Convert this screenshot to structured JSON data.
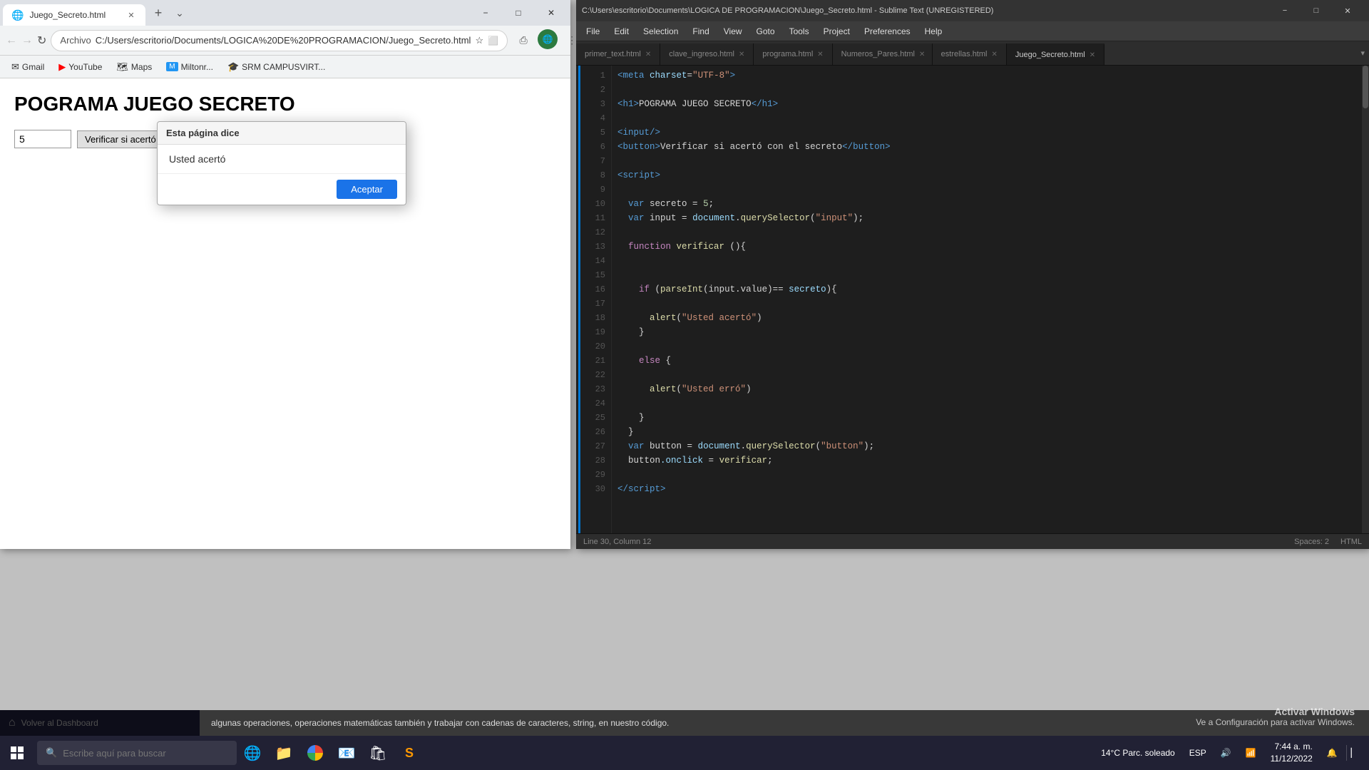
{
  "chrome": {
    "tab_title": "Juego_Secreto.html",
    "tab_favicon": "🌐",
    "address_protocol": "Archivo",
    "address_url": "C:/Users/escritorio/Documents/LOGICA%20DE%20PROGRAMACION/Juego_Secreto.html",
    "new_tab_label": "+",
    "win_controls": {
      "minimize": "−",
      "maximize": "□",
      "close": "✕"
    },
    "nav": {
      "back": "←",
      "forward": "→",
      "refresh": "↻"
    },
    "bookmarks": [
      {
        "label": "Gmail",
        "favicon": "✉"
      },
      {
        "label": "YouTube",
        "favicon": "▶"
      },
      {
        "label": "Maps",
        "favicon": "🗺"
      },
      {
        "label": "Miltonr...",
        "favicon": "M"
      },
      {
        "label": "SRM CAMPUSVIRT...",
        "favicon": "🎓"
      }
    ],
    "page": {
      "title": "POGRAMA JUEGO SECRETO",
      "input_value": "5",
      "button_label": "Verificar si acertó"
    },
    "alert": {
      "header": "Esta página dice",
      "message": "Usted acertó",
      "button": "Aceptar"
    }
  },
  "sublime": {
    "titlebar": "C:\\Users\\escritorio\\Documents\\LOGICA DE PROGRAMACION\\Juego_Secreto.html - Sublime Text (UNREGISTERED)",
    "win_controls": {
      "minimize": "−",
      "maximize": "□",
      "close": "✕"
    },
    "menu_items": [
      "File",
      "Edit",
      "Selection",
      "Find",
      "View",
      "Goto",
      "Tools",
      "Project",
      "Preferences",
      "Help"
    ],
    "tabs": [
      {
        "label": "primer_text.html",
        "active": false
      },
      {
        "label": "clave_ingreso.html",
        "active": false
      },
      {
        "label": "programa.html",
        "active": false
      },
      {
        "label": "Numeros_Pares.html",
        "active": false
      },
      {
        "label": "estrellas.html",
        "active": false
      },
      {
        "label": "Juego_Secreto.html",
        "active": true
      }
    ],
    "code_lines": [
      {
        "num": 1,
        "tokens": [
          {
            "text": "<",
            "cls": "kw-tag"
          },
          {
            "text": "meta",
            "cls": "kw-tag"
          },
          {
            "text": " charset",
            "cls": "kw-attr"
          },
          {
            "text": "=",
            "cls": "kw-plain"
          },
          {
            "text": "\"UTF-8\"",
            "cls": "kw-str"
          },
          {
            "text": ">",
            "cls": "kw-tag"
          }
        ]
      },
      {
        "num": 2,
        "tokens": []
      },
      {
        "num": 3,
        "tokens": [
          {
            "text": "<",
            "cls": "kw-tag"
          },
          {
            "text": "h1",
            "cls": "kw-tag"
          },
          {
            "text": ">",
            "cls": "kw-tag"
          },
          {
            "text": "POGRAMA JUEGO SECRETO",
            "cls": "kw-plain"
          },
          {
            "text": "</",
            "cls": "kw-tag"
          },
          {
            "text": "h1",
            "cls": "kw-tag"
          },
          {
            "text": ">",
            "cls": "kw-tag"
          }
        ]
      },
      {
        "num": 4,
        "tokens": []
      },
      {
        "num": 5,
        "tokens": [
          {
            "text": "<",
            "cls": "kw-tag"
          },
          {
            "text": "input",
            "cls": "kw-tag"
          },
          {
            "text": "/>",
            "cls": "kw-tag"
          }
        ]
      },
      {
        "num": 6,
        "tokens": [
          {
            "text": "<",
            "cls": "kw-tag"
          },
          {
            "text": "button",
            "cls": "kw-tag"
          },
          {
            "text": ">",
            "cls": "kw-tag"
          },
          {
            "text": "Verificar si acertó con el secreto",
            "cls": "kw-plain"
          },
          {
            "text": "</",
            "cls": "kw-tag"
          },
          {
            "text": "button",
            "cls": "kw-tag"
          },
          {
            "text": ">",
            "cls": "kw-tag"
          }
        ]
      },
      {
        "num": 7,
        "tokens": []
      },
      {
        "num": 8,
        "tokens": [
          {
            "text": "<",
            "cls": "kw-tag"
          },
          {
            "text": "script",
            "cls": "kw-tag"
          },
          {
            "text": ">",
            "cls": "kw-tag"
          }
        ]
      },
      {
        "num": 9,
        "tokens": []
      },
      {
        "num": 10,
        "tokens": [
          {
            "text": "  ",
            "cls": "kw-plain"
          },
          {
            "text": "var",
            "cls": "kw-blue"
          },
          {
            "text": " secreto ",
            "cls": "kw-plain"
          },
          {
            "text": "=",
            "cls": "kw-plain"
          },
          {
            "text": " 5",
            "cls": "kw-num"
          },
          {
            "text": ";",
            "cls": "kw-plain"
          }
        ]
      },
      {
        "num": 11,
        "tokens": [
          {
            "text": "  ",
            "cls": "kw-plain"
          },
          {
            "text": "var",
            "cls": "kw-blue"
          },
          {
            "text": " input ",
            "cls": "kw-plain"
          },
          {
            "text": "=",
            "cls": "kw-plain"
          },
          {
            "text": " document",
            "cls": "kw-prop"
          },
          {
            "text": ".",
            "cls": "kw-plain"
          },
          {
            "text": "querySelector",
            "cls": "kw-fn"
          },
          {
            "text": "(",
            "cls": "kw-plain"
          },
          {
            "text": "\"input\"",
            "cls": "kw-str"
          },
          {
            "text": ");",
            "cls": "kw-plain"
          }
        ]
      },
      {
        "num": 12,
        "tokens": []
      },
      {
        "num": 13,
        "tokens": [
          {
            "text": "  ",
            "cls": "kw-plain"
          },
          {
            "text": "function",
            "cls": "kw-keyword"
          },
          {
            "text": " verificar ",
            "cls": "kw-fn"
          },
          {
            "text": "(){",
            "cls": "kw-plain"
          }
        ]
      },
      {
        "num": 14,
        "tokens": []
      },
      {
        "num": 15,
        "tokens": []
      },
      {
        "num": 16,
        "tokens": [
          {
            "text": "    ",
            "cls": "kw-plain"
          },
          {
            "text": "if",
            "cls": "kw-keyword"
          },
          {
            "text": " (",
            "cls": "kw-plain"
          },
          {
            "text": "parseInt",
            "cls": "kw-fn"
          },
          {
            "text": "(input.value)",
            "cls": "kw-plain"
          },
          {
            "text": "==",
            "cls": "kw-plain"
          },
          {
            "text": " secreto",
            "cls": "kw-prop"
          },
          {
            "text": "){",
            "cls": "kw-plain"
          }
        ]
      },
      {
        "num": 17,
        "tokens": []
      },
      {
        "num": 18,
        "tokens": [
          {
            "text": "      ",
            "cls": "kw-plain"
          },
          {
            "text": "alert",
            "cls": "kw-fn"
          },
          {
            "text": "(",
            "cls": "kw-plain"
          },
          {
            "text": "\"Usted acertó\"",
            "cls": "kw-str"
          },
          {
            "text": ")",
            "cls": "kw-plain"
          }
        ]
      },
      {
        "num": 19,
        "tokens": [
          {
            "text": "    ",
            "cls": "kw-plain"
          },
          {
            "text": "}",
            "cls": "kw-plain"
          }
        ]
      },
      {
        "num": 20,
        "tokens": []
      },
      {
        "num": 21,
        "tokens": [
          {
            "text": "    ",
            "cls": "kw-plain"
          },
          {
            "text": "else",
            "cls": "kw-keyword"
          },
          {
            "text": " {",
            "cls": "kw-plain"
          }
        ]
      },
      {
        "num": 22,
        "tokens": []
      },
      {
        "num": 23,
        "tokens": [
          {
            "text": "      ",
            "cls": "kw-plain"
          },
          {
            "text": "alert",
            "cls": "kw-fn"
          },
          {
            "text": "(",
            "cls": "kw-plain"
          },
          {
            "text": "\"Usted erró\"",
            "cls": "kw-str"
          },
          {
            "text": ")",
            "cls": "kw-plain"
          }
        ]
      },
      {
        "num": 24,
        "tokens": []
      },
      {
        "num": 25,
        "tokens": [
          {
            "text": "    ",
            "cls": "kw-plain"
          },
          {
            "text": "}",
            "cls": "kw-plain"
          }
        ]
      },
      {
        "num": 26,
        "tokens": [
          {
            "text": "  ",
            "cls": "kw-plain"
          },
          {
            "text": "}",
            "cls": "kw-plain"
          }
        ]
      },
      {
        "num": 27,
        "tokens": [
          {
            "text": "  ",
            "cls": "kw-plain"
          },
          {
            "text": "var",
            "cls": "kw-blue"
          },
          {
            "text": " button ",
            "cls": "kw-plain"
          },
          {
            "text": "=",
            "cls": "kw-plain"
          },
          {
            "text": " document",
            "cls": "kw-prop"
          },
          {
            "text": ".",
            "cls": "kw-plain"
          },
          {
            "text": "querySelector",
            "cls": "kw-fn"
          },
          {
            "text": "(",
            "cls": "kw-plain"
          },
          {
            "text": "\"button\"",
            "cls": "kw-str"
          },
          {
            "text": ");",
            "cls": "kw-plain"
          }
        ]
      },
      {
        "num": 28,
        "tokens": [
          {
            "text": "  ",
            "cls": "kw-plain"
          },
          {
            "text": "button",
            "cls": "kw-plain"
          },
          {
            "text": ".onclick ",
            "cls": "kw-prop"
          },
          {
            "text": "=",
            "cls": "kw-plain"
          },
          {
            "text": " verificar",
            "cls": "kw-fn"
          },
          {
            "text": ";",
            "cls": "kw-plain"
          }
        ]
      },
      {
        "num": 29,
        "tokens": []
      },
      {
        "num": 30,
        "tokens": [
          {
            "text": "</",
            "cls": "kw-tag"
          },
          {
            "text": "script",
            "cls": "kw-tag"
          },
          {
            "text": ">",
            "cls": "kw-tag"
          }
        ]
      }
    ],
    "statusbar": {
      "position": "Line 30, Column 12",
      "spaces": "Spaces: 2",
      "filetype": "HTML"
    }
  },
  "bottom_bar": {
    "dashboard_label": "Volver al Dashboard",
    "campus_text": "algunas operaciones, operaciones matemáticas también y trabajar con cadenas de caracteres, string, en nuestro código."
  },
  "taskbar": {
    "search_placeholder": "Escribe aquí para buscar",
    "clock": "7:44 a. m.",
    "date": "11/12/2022",
    "weather": "14°C  Parc. soleado",
    "lang": "ESP"
  },
  "activate_watermark": {
    "line1": "Activar Windows",
    "line2": "Ve a Configuración para activar Windows."
  }
}
